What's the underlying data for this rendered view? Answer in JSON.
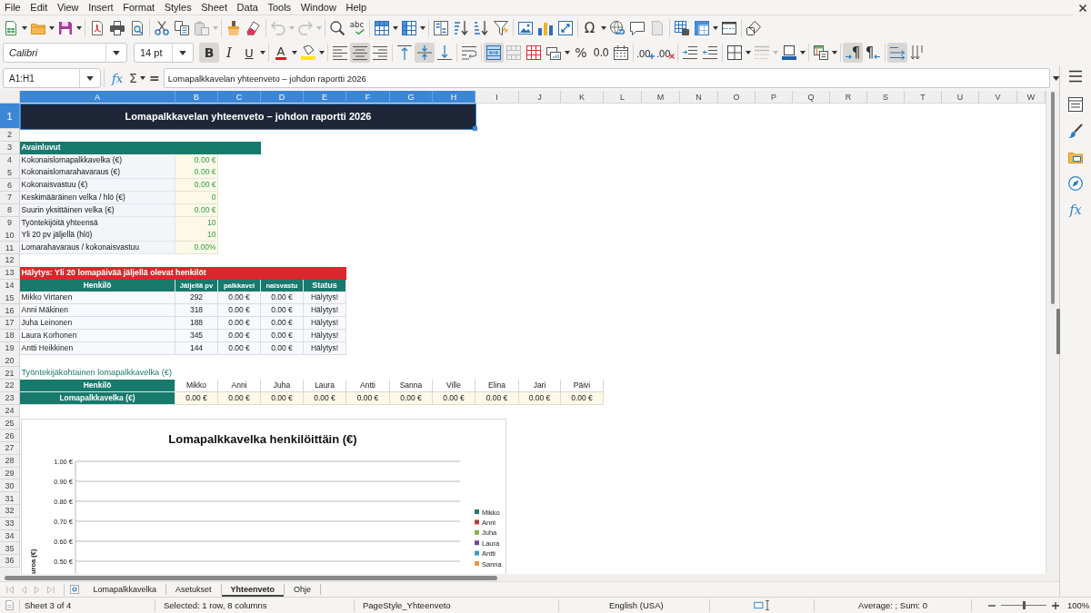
{
  "menu_bar": [
    "File",
    "Edit",
    "View",
    "Insert",
    "Format",
    "Styles",
    "Sheet",
    "Data",
    "Tools",
    "Window",
    "Help"
  ],
  "standard_toolbar": {
    "spelling_glyph": "abc",
    "special_character_glyph": "Ω"
  },
  "formatting_toolbar": {
    "font_name": "Calibri",
    "font_size": "14 pt",
    "style_toggles": [
      {
        "kind": "bold",
        "glyph": "B",
        "on": true
      },
      {
        "kind": "italic",
        "glyph": "I",
        "on": false
      },
      {
        "kind": "underline",
        "glyph": "U",
        "on": false
      }
    ],
    "font_color_glyph": "A",
    "horizontal_align": [
      {
        "kind": "left",
        "selected": false
      },
      {
        "kind": "center",
        "selected": true
      },
      {
        "kind": "right",
        "selected": false
      }
    ],
    "vertical_align": [
      {
        "kind": "top",
        "selected": false
      },
      {
        "kind": "middle",
        "selected": true
      },
      {
        "kind": "bottom",
        "selected": false
      }
    ],
    "merge_and_center": true,
    "percent_glyph": "%",
    "number_glyph": "0.0",
    "decimal_buttons": [
      {
        "kind": "add",
        "glyph": ".00"
      },
      {
        "kind": "delete",
        "glyph": ".00"
      }
    ],
    "paragraph_direction": [
      {
        "kind": "ltr",
        "glyph": "¶",
        "selected": true
      },
      {
        "kind": "rtl",
        "glyph": "¶",
        "selected": false
      }
    ],
    "text_direction": [
      {
        "kind": "horizontal",
        "selected": true
      },
      {
        "kind": "vertical",
        "selected": false
      }
    ]
  },
  "formula_bar": {
    "name_box": "A1:H1",
    "function_glyph": "fx",
    "sum_glyph": "Σ",
    "equals_glyph": "=",
    "content": "Lomapalkkavelan yhteenveto – johdon raportti 2026"
  },
  "sheet": {
    "columns": [
      {
        "label": "A",
        "selected": true
      },
      {
        "label": "B",
        "selected": true
      },
      {
        "label": "C",
        "selected": true
      },
      {
        "label": "D",
        "selected": true
      },
      {
        "label": "E",
        "selected": true
      },
      {
        "label": "F",
        "selected": true
      },
      {
        "label": "G",
        "selected": true
      },
      {
        "label": "H",
        "selected": true
      },
      {
        "label": "I",
        "selected": false
      },
      {
        "label": "J",
        "selected": false
      },
      {
        "label": "K",
        "selected": false
      },
      {
        "label": "L",
        "selected": false
      },
      {
        "label": "M",
        "selected": false
      },
      {
        "label": "N",
        "selected": false
      },
      {
        "label": "O",
        "selected": false
      },
      {
        "label": "P",
        "selected": false
      },
      {
        "label": "Q",
        "selected": false
      },
      {
        "label": "R",
        "selected": false
      },
      {
        "label": "S",
        "selected": false
      },
      {
        "label": "T",
        "selected": false
      },
      {
        "label": "U",
        "selected": false
      },
      {
        "label": "V",
        "selected": false
      },
      {
        "label": "W",
        "selected": false
      }
    ],
    "row_headers": [
      {
        "label": "1",
        "selected": true
      },
      {
        "label": "2",
        "selected": false
      },
      {
        "label": "3",
        "selected": false
      },
      {
        "label": "4",
        "selected": false
      },
      {
        "label": "5",
        "selected": false
      },
      {
        "label": "6",
        "selected": false
      },
      {
        "label": "7",
        "selected": false
      },
      {
        "label": "8",
        "selected": false
      },
      {
        "label": "9",
        "selected": false
      },
      {
        "label": "10",
        "selected": false
      },
      {
        "label": "11",
        "selected": false
      },
      {
        "label": "12",
        "selected": false
      },
      {
        "label": "13",
        "selected": false
      },
      {
        "label": "14",
        "selected": false
      },
      {
        "label": "15",
        "selected": false
      },
      {
        "label": "16",
        "selected": false
      },
      {
        "label": "17",
        "selected": false
      },
      {
        "label": "18",
        "selected": false
      },
      {
        "label": "19",
        "selected": false
      },
      {
        "label": "20",
        "selected": false
      },
      {
        "label": "21",
        "selected": false
      },
      {
        "label": "22",
        "selected": false
      },
      {
        "label": "23",
        "selected": false
      },
      {
        "label": "24",
        "selected": false
      },
      {
        "label": "25",
        "selected": false
      },
      {
        "label": "26",
        "selected": false
      },
      {
        "label": "27",
        "selected": false
      },
      {
        "label": "28",
        "selected": false
      },
      {
        "label": "29",
        "selected": false
      },
      {
        "label": "30",
        "selected": false
      },
      {
        "label": "31",
        "selected": false
      },
      {
        "label": "32",
        "selected": false
      },
      {
        "label": "33",
        "selected": false
      },
      {
        "label": "34",
        "selected": false
      },
      {
        "label": "35",
        "selected": false
      },
      {
        "label": "36",
        "selected": false
      }
    ],
    "title": "Lomapalkkavelan yhteenveto – johdon raportti 2026",
    "key_figures": {
      "heading": "Avainluvut",
      "rows": [
        {
          "label": "Kokonaislomapalkkavelka (€)",
          "value": "0.00 €"
        },
        {
          "label": "Kokonaislomarahavaraus (€)",
          "value": "0.00 €"
        },
        {
          "label": "Kokonaisvastuu (€)",
          "value": "0.00 €"
        },
        {
          "label": "Keskimääräinen velka / hlö (€)",
          "value": "0"
        },
        {
          "label": "Suurin yksittäinen velka (€)",
          "value": "0.00 €"
        },
        {
          "label": "Työntekijöitä yhteensä",
          "value": "10"
        },
        {
          "label": "Yli 20 pv jäljellä (hlö)",
          "value": "10"
        },
        {
          "label": "Lomarahavaraus / kokonaisvastuu",
          "value": "0.00%"
        }
      ]
    },
    "alert_table": {
      "heading": "Hälytys: Yli 20 lomapäivää jäljellä olevat henkilöt",
      "columns": [
        "Henkilö",
        "Jäljellä pv",
        "palkkavel",
        "naisvastu",
        "Status"
      ],
      "rows": [
        [
          "Mikko Virtanen",
          "292",
          "0.00 €",
          "0.00 €",
          "Hälytys!"
        ],
        [
          "Anni Mäkinen",
          "318",
          "0.00 €",
          "0.00 €",
          "Hälytys!"
        ],
        [
          "Juha Leinonen",
          "188",
          "0.00 €",
          "0.00 €",
          "Hälytys!"
        ],
        [
          "Laura Korhonen",
          "345",
          "0.00 €",
          "0.00 €",
          "Hälytys!"
        ],
        [
          "Antti Heikkinen",
          "144",
          "0.00 €",
          "0.00 €",
          "Hälytys!"
        ]
      ]
    },
    "employee_debt": {
      "title": "Työntekijäkohtainen lomapalkkavelka (€)",
      "header_label": "Henkilö",
      "value_label": "Lomapalkkavelka (€)",
      "names": [
        "Mikko",
        "Anni",
        "Juha",
        "Laura",
        "Antti",
        "Sanna",
        "Ville",
        "Elina",
        "Jari",
        "Päivi"
      ],
      "values": [
        "0.00 €",
        "0.00 €",
        "0.00 €",
        "0.00 €",
        "0.00 €",
        "0.00 €",
        "0.00 €",
        "0.00 €",
        "0.00 €",
        "0.00 €"
      ]
    },
    "chart": {
      "chart_data": {
        "type": "bar",
        "title": "Lomapalkkavelka henkilöittäin (€)",
        "ylabel": "uroa (€)",
        "grid": true,
        "ylim": [
          0,
          1
        ],
        "yticks": [
          {
            "value": 1.0,
            "label": "1.00 €"
          },
          {
            "value": 0.9,
            "label": "0.90 €"
          },
          {
            "value": 0.8,
            "label": "0.80 €"
          },
          {
            "value": 0.7,
            "label": "0.70 €"
          },
          {
            "value": 0.6,
            "label": "0.60 €"
          },
          {
            "value": 0.5,
            "label": "0.50 €"
          }
        ],
        "series": [
          {
            "name": "Mikko",
            "color": "#1f7a6c"
          },
          {
            "name": "Anni",
            "color": "#b5443a"
          },
          {
            "name": "Juha",
            "color": "#82b347"
          },
          {
            "name": "Laura",
            "color": "#6b4c9a"
          },
          {
            "name": "Antti",
            "color": "#3d9fb6"
          },
          {
            "name": "Sanna",
            "color": "#e39a4c"
          }
        ]
      }
    }
  },
  "sheet_tabs": [
    {
      "label": "Lomapalkkavelka",
      "selected": false
    },
    {
      "label": "Asetukset",
      "selected": false
    },
    {
      "label": "Yhteenveto",
      "selected": true
    },
    {
      "label": "Ohje",
      "selected": false
    }
  ],
  "sidebar": {
    "functions_glyph": "fx"
  },
  "status_bar": {
    "sheet": "Sheet 3 of 4",
    "selection": "Selected: 1 row, 8 columns",
    "page_style": "PageStyle_Yhteenveto",
    "language": "English (USA)",
    "summary": "Average: ; Sum: 0",
    "zoom": {
      "level": 0.5,
      "label": "100%"
    }
  }
}
